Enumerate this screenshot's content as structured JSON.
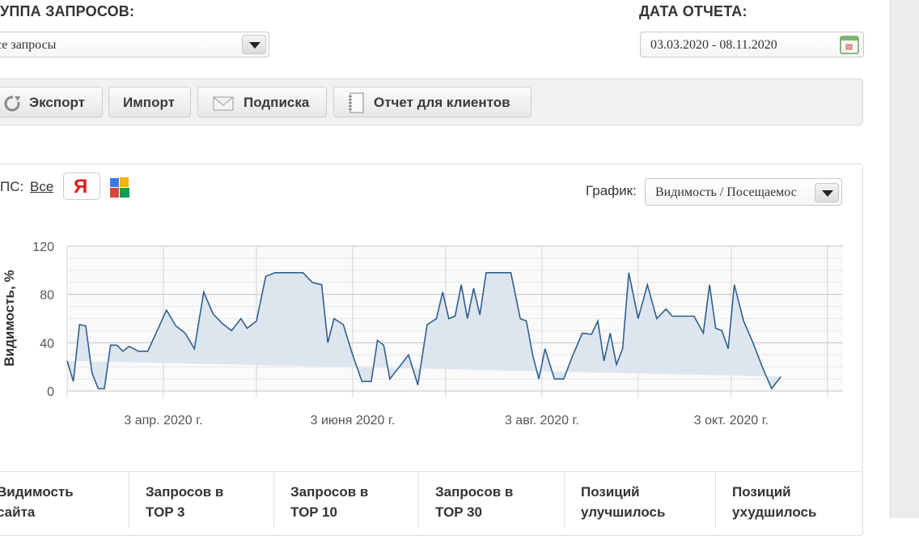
{
  "header": {
    "group_label": "УППА ЗАПРОСОВ:",
    "group_value": "се запросы",
    "date_label": "ДАТА ОТЧЕТА:",
    "date_value": "03.03.2020 - 08.11.2020"
  },
  "toolbar": {
    "export_label": "Экспорт",
    "import_label": "Импорт",
    "subscribe_label": "Подписка",
    "client_report_label": "Отчет для клиентов"
  },
  "filters": {
    "ps_label": "ПС:",
    "ps_all_label": "Все",
    "yandex_letter": "Я",
    "graph_label": "График:",
    "graph_select_value": "Видимость / Посещаемос"
  },
  "chart_data": {
    "type": "area",
    "ylabel": "Видимость, %",
    "ylim": [
      0,
      120
    ],
    "yticks": [
      "0",
      "40",
      "80",
      "120"
    ],
    "x_tick_labels": [
      "3 апр. 2020 г.",
      "3 июня 2020 г.",
      "3 авг. 2020 г.",
      "3 окт. 2020 г."
    ],
    "x_range": [
      "2020-03-03",
      "2020-11-08"
    ],
    "grid": true,
    "color": "#2f5f8f",
    "fill": "#dde6ef",
    "x": [
      "2020-03-03",
      "2020-03-05",
      "2020-03-07",
      "2020-03-09",
      "2020-03-11",
      "2020-03-13",
      "2020-03-15",
      "2020-03-17",
      "2020-03-19",
      "2020-03-21",
      "2020-03-23",
      "2020-03-26",
      "2020-03-29",
      "2020-04-01",
      "2020-04-04",
      "2020-04-07",
      "2020-04-10",
      "2020-04-13",
      "2020-04-16",
      "2020-04-19",
      "2020-04-22",
      "2020-04-25",
      "2020-04-28",
      "2020-04-30",
      "2020-05-03",
      "2020-05-06",
      "2020-05-09",
      "2020-05-12",
      "2020-05-15",
      "2020-05-18",
      "2020-05-21",
      "2020-05-24",
      "2020-05-26",
      "2020-05-28",
      "2020-05-31",
      "2020-06-03",
      "2020-06-06",
      "2020-06-09",
      "2020-06-11",
      "2020-06-13",
      "2020-06-15",
      "2020-06-18",
      "2020-06-21",
      "2020-06-24",
      "2020-06-27",
      "2020-06-30",
      "2020-07-02",
      "2020-07-04",
      "2020-07-06",
      "2020-07-08",
      "2020-07-10",
      "2020-07-12",
      "2020-07-14",
      "2020-07-16",
      "2020-07-18",
      "2020-07-21",
      "2020-07-24",
      "2020-07-27",
      "2020-07-29",
      "2020-07-31",
      "2020-08-02",
      "2020-08-04",
      "2020-08-07",
      "2020-08-10",
      "2020-08-13",
      "2020-08-16",
      "2020-08-19",
      "2020-08-21",
      "2020-08-23",
      "2020-08-25",
      "2020-08-27",
      "2020-08-29",
      "2020-08-31",
      "2020-09-03",
      "2020-09-06",
      "2020-09-09",
      "2020-09-12",
      "2020-09-14",
      "2020-09-16",
      "2020-09-18",
      "2020-09-21",
      "2020-09-24",
      "2020-09-26",
      "2020-09-28",
      "2020-09-30",
      "2020-10-02",
      "2020-10-04",
      "2020-10-07",
      "2020-10-10",
      "2020-10-13",
      "2020-10-16",
      "2020-10-19",
      "2020-10-21",
      "2020-10-23",
      "2020-10-25",
      "2020-10-27",
      "2020-10-29",
      "2020-10-31",
      "2020-11-02",
      "2020-11-04",
      "2020-11-06",
      "2020-11-08"
    ],
    "series": [
      {
        "values": [
          25,
          8,
          55,
          54,
          15,
          2,
          2,
          38,
          38,
          33,
          37,
          33,
          33,
          50,
          67,
          54,
          48,
          35,
          82,
          64,
          56,
          50,
          60,
          52,
          58,
          95,
          98,
          98,
          98,
          98,
          90,
          88,
          40,
          60,
          55,
          30,
          8,
          8,
          42,
          38,
          10,
          20,
          30,
          5,
          55,
          60,
          82,
          60,
          62,
          88,
          60,
          85,
          63,
          98,
          98,
          98,
          98,
          60,
          58,
          30,
          10,
          35,
          10,
          10,
          30,
          48,
          47,
          58,
          25,
          48,
          22,
          35,
          98,
          60,
          88,
          60,
          68,
          62,
          62,
          62,
          62,
          48,
          88,
          52,
          50,
          35,
          88,
          58,
          40,
          20,
          2,
          12
        ]
      }
    ]
  },
  "stats": {
    "headers": [
      "Видимость\nсайта",
      "Запросов в\nTOP 3",
      "Запросов в\nTOP 10",
      "Запросов в\nTOP 30",
      "Позиций\nулучшилось",
      "Позиций\nухудшилось"
    ]
  }
}
